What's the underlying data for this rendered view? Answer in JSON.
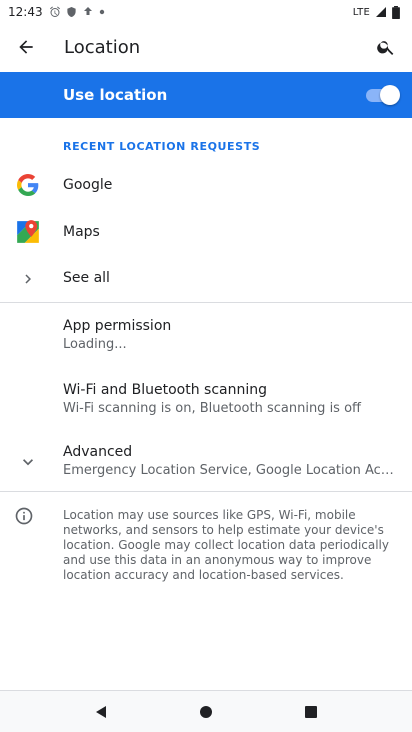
{
  "status_bar": {
    "time": "12:43",
    "network": "LTE",
    "icons": [
      "alarm-icon",
      "shield-icon",
      "cast-icon",
      "dot-icon"
    ]
  },
  "app_bar": {
    "title": "Location",
    "back_icon": "arrow-back-icon",
    "search_icon": "search-icon"
  },
  "use_location": {
    "label": "Use location",
    "enabled": true,
    "colors": {
      "background": "#1a73e8",
      "thumb": "#ffffff",
      "track": "#8ab4f8"
    }
  },
  "recent_requests": {
    "header": "RECENT LOCATION REQUESTS",
    "items": [
      {
        "label": "Google",
        "icon": "google-icon"
      },
      {
        "label": "Maps",
        "icon": "maps-icon"
      }
    ],
    "see_all": "See all"
  },
  "settings": {
    "app_permission": {
      "title": "App permission",
      "subtitle": "Loading..."
    },
    "wifi_bt_scanning": {
      "title": "Wi-Fi and Bluetooth scanning",
      "subtitle": "Wi-Fi scanning is on, Bluetooth scanning is off"
    },
    "advanced": {
      "title": "Advanced",
      "subtitle": "Emergency Location Service, Google Location Accuracy, Goo..."
    }
  },
  "footer": {
    "text": "Location may use sources like GPS, Wi-Fi, mobile networks, and sensors to help estimate your device's location. Google may collect location data periodically and use this data in an anonymous way to improve location accuracy and location-based services."
  },
  "nav_bar": {
    "buttons": [
      "back-icon",
      "home-icon",
      "recents-icon"
    ]
  }
}
